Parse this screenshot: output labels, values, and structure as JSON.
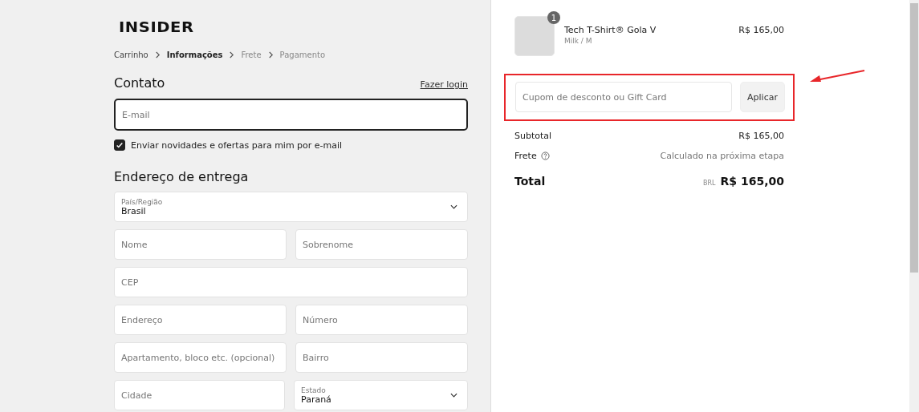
{
  "brand": {
    "logo": "INSIDER"
  },
  "breadcrumb": [
    {
      "label": "Carrinho",
      "kind": "done"
    },
    {
      "label": "Informações",
      "kind": "current"
    },
    {
      "label": "Frete",
      "kind": "upcoming"
    },
    {
      "label": "Pagamento",
      "kind": "upcoming"
    }
  ],
  "contact": {
    "title": "Contato",
    "login_link": "Fazer login",
    "email": {
      "placeholder": "E-mail",
      "focused": true
    },
    "newsletter": {
      "label": "Enviar novidades e ofertas para mim por e-mail",
      "checked": true
    }
  },
  "delivery": {
    "title": "Endereço de entrega",
    "rows": [
      [
        {
          "kind": "select",
          "label": "País/Região",
          "value": "Brasil"
        }
      ],
      [
        {
          "kind": "text",
          "placeholder": "Nome"
        },
        {
          "kind": "text",
          "placeholder": "Sobrenome"
        }
      ],
      [
        {
          "kind": "text",
          "placeholder": "CEP"
        }
      ],
      [
        {
          "kind": "text",
          "placeholder": "Endereço"
        },
        {
          "kind": "text",
          "placeholder": "Número"
        }
      ],
      [
        {
          "kind": "text",
          "placeholder": "Apartamento, bloco etc. (opcional)"
        },
        {
          "kind": "text",
          "placeholder": "Bairro"
        }
      ],
      [
        {
          "kind": "text",
          "placeholder": "Cidade"
        },
        {
          "kind": "select",
          "label": "Estado",
          "value": "Paraná"
        }
      ]
    ]
  },
  "cart": {
    "items": [
      {
        "name": "Tech T-Shirt® Gola V",
        "variant": "Milk / M",
        "quantity": "1",
        "price": "R$ 165,00"
      }
    ],
    "discount": {
      "placeholder": "Cupom de desconto ou Gift Card",
      "button": "Aplicar",
      "highlighted": true
    },
    "lines": [
      {
        "label": "Subtotal",
        "value": "R$ 165,00",
        "help": false
      },
      {
        "label": "Frete",
        "value": "Calculado na próxima etapa",
        "help": true
      }
    ],
    "total": {
      "label": "Total",
      "currency": "BRL",
      "value": "R$ 165,00"
    }
  }
}
